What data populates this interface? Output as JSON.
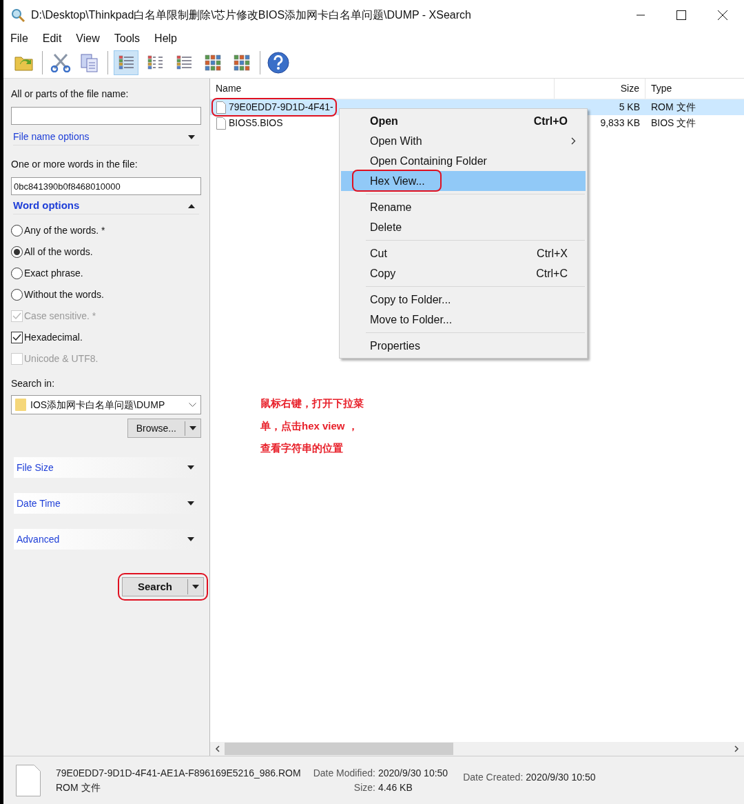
{
  "window": {
    "title": "D:\\Desktop\\Thinkpad白名单限制删除\\芯片修改BIOS添加网卡白名单问题\\DUMP - XSearch"
  },
  "menu_bar": [
    "File",
    "Edit",
    "View",
    "Tools",
    "Help"
  ],
  "toolbar": [
    {
      "kind": "folder",
      "selected": false
    },
    {
      "kind": "cut",
      "selected": false
    },
    {
      "kind": "copy",
      "selected": false
    },
    {
      "kind": "details",
      "selected": true
    },
    {
      "kind": "list",
      "selected": false
    },
    {
      "kind": "tiles",
      "selected": false
    },
    {
      "kind": "icons",
      "selected": false
    },
    {
      "kind": "thumbs",
      "selected": false
    },
    {
      "kind": "help",
      "selected": false
    }
  ],
  "search_panel": {
    "file_name": {
      "label": "All or parts of the file name:"
    },
    "file_name_options": {
      "label": "File name options",
      "expanded": false
    },
    "words": {
      "label": "One or more words in the file:",
      "value": "0bc841390b0f8468010000"
    },
    "word_options": {
      "label": "Word options",
      "expanded": true
    },
    "match": [
      {
        "label": "Any of the words. *",
        "selected": false
      },
      {
        "label": "All of the words.",
        "selected": true
      },
      {
        "label": "Exact phrase.",
        "selected": false
      },
      {
        "label": "Without the words.",
        "selected": false
      }
    ],
    "checks": [
      {
        "label": "Case sensitive. *",
        "checked": true,
        "disabled": true
      },
      {
        "label": "Hexadecimal.",
        "checked": true,
        "disabled": false
      },
      {
        "label": "Unicode & UTF8.",
        "checked": false,
        "disabled": true
      }
    ],
    "search_in": {
      "label": "Search in:",
      "value": "IOS添加网卡白名单问题\\DUMP"
    },
    "browse": "Browse...",
    "sections": [
      {
        "label": "File Size",
        "expanded": false
      },
      {
        "label": "Date Time",
        "expanded": false
      },
      {
        "label": "Advanced",
        "expanded": false
      }
    ],
    "search_button": "Search"
  },
  "file_list": {
    "columns": [
      "Name",
      "Size",
      "Type"
    ],
    "rows": [
      {
        "name": "79E0EDD7-9D1D-4F41-",
        "size": "5 KB",
        "type": "ROM 文件",
        "selected": true
      },
      {
        "name": "BIOS5.BIOS",
        "size": "9,833 KB",
        "type": "BIOS 文件",
        "selected": false
      }
    ]
  },
  "context_menu": [
    {
      "kind": "item",
      "label": "Open",
      "shortcut": "Ctrl+O",
      "bold": true,
      "submenu": false,
      "selected": false
    },
    {
      "kind": "item",
      "label": "Open With",
      "bold": false,
      "submenu": true,
      "selected": false
    },
    {
      "kind": "item",
      "label": "Open Containing Folder",
      "bold": false,
      "submenu": false,
      "selected": false
    },
    {
      "kind": "item",
      "label": "Hex View...",
      "bold": false,
      "submenu": false,
      "selected": true
    },
    {
      "kind": "separator"
    },
    {
      "kind": "item",
      "label": "Rename",
      "bold": false,
      "submenu": false,
      "selected": false
    },
    {
      "kind": "item",
      "label": "Delete",
      "bold": false,
      "submenu": false,
      "selected": false
    },
    {
      "kind": "separator"
    },
    {
      "kind": "item",
      "label": "Cut",
      "shortcut": "Ctrl+X",
      "bold": false,
      "submenu": false,
      "selected": false
    },
    {
      "kind": "item",
      "label": "Copy",
      "shortcut": "Ctrl+C",
      "bold": false,
      "submenu": false,
      "selected": false
    },
    {
      "kind": "separator"
    },
    {
      "kind": "item",
      "label": "Copy to Folder...",
      "bold": false,
      "submenu": false,
      "selected": false
    },
    {
      "kind": "item",
      "label": "Move to Folder...",
      "bold": false,
      "submenu": false,
      "selected": false
    },
    {
      "kind": "separator"
    },
    {
      "kind": "item",
      "label": "Properties",
      "bold": false,
      "submenu": false,
      "selected": false
    }
  ],
  "note": {
    "lines": [
      "鼠标右键，打开下拉菜",
      "单，点击hex view ，",
      "查看字符串的位置"
    ]
  },
  "status_bar": {
    "file_name": "79E0EDD7-9D1D-4F41-AE1A-F896169E5216_986.ROM",
    "file_type": "ROM 文件",
    "modified_label": "Date Modified:",
    "modified": "2020/9/30 10:50",
    "size_label": "Size:",
    "size": "4.46 KB",
    "created_label": "Date Created:",
    "created": "2020/9/30 10:50"
  }
}
